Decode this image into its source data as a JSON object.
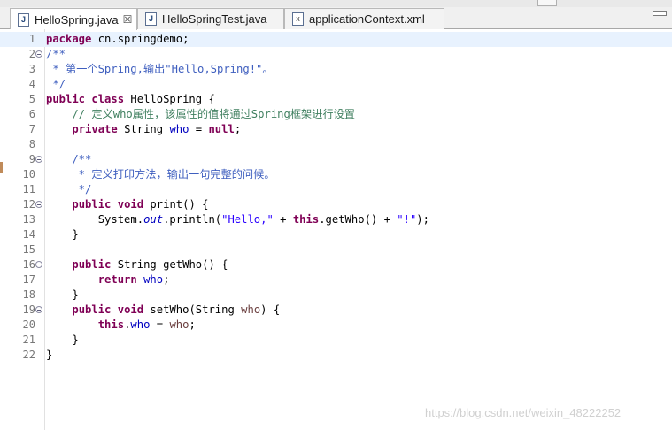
{
  "tabs": [
    {
      "label": "HelloSpring.java",
      "icon": "java-file-icon",
      "icon_glyph": "J",
      "active": true,
      "close": "☒"
    },
    {
      "label": "HelloSpringTest.java",
      "icon": "java-file-icon",
      "icon_glyph": "J",
      "active": false
    },
    {
      "label": "applicationContext.xml",
      "icon": "xml-file-icon",
      "icon_glyph": "x",
      "active": false
    }
  ],
  "editor": {
    "lines": [
      {
        "n": "1",
        "current": true,
        "fold": false,
        "tokens": [
          {
            "t": "package",
            "c": "kw"
          },
          {
            "t": " cn.springdemo;",
            "c": ""
          }
        ]
      },
      {
        "n": "2",
        "fold": true,
        "tokens": [
          {
            "t": "/**",
            "c": "cm"
          }
        ]
      },
      {
        "n": "3",
        "tokens": [
          {
            "t": " * 第一个Spring,输出\"Hello,Spring!\"。",
            "c": "cm"
          }
        ]
      },
      {
        "n": "4",
        "tokens": [
          {
            "t": " */",
            "c": "cm"
          }
        ]
      },
      {
        "n": "5",
        "tokens": [
          {
            "t": "public",
            "c": "kw"
          },
          {
            "t": " ",
            "c": ""
          },
          {
            "t": "class",
            "c": "kw"
          },
          {
            "t": " HelloSpring {",
            "c": ""
          }
        ]
      },
      {
        "n": "6",
        "tokens": [
          {
            "t": "    // 定义who属性，该属性的值将通过Spring框架进行设置",
            "c": "cl"
          }
        ]
      },
      {
        "n": "7",
        "tokens": [
          {
            "t": "    ",
            "c": ""
          },
          {
            "t": "private",
            "c": "kw"
          },
          {
            "t": " String ",
            "c": ""
          },
          {
            "t": "who",
            "c": "fld"
          },
          {
            "t": " = ",
            "c": ""
          },
          {
            "t": "null",
            "c": "kw"
          },
          {
            "t": ";",
            "c": ""
          }
        ]
      },
      {
        "n": "8",
        "tokens": []
      },
      {
        "n": "9",
        "fold": true,
        "tokens": [
          {
            "t": "    /**",
            "c": "cm"
          }
        ]
      },
      {
        "n": "10",
        "tokens": [
          {
            "t": "     * 定义打印方法，输出一句完整的问候。",
            "c": "cm"
          }
        ]
      },
      {
        "n": "11",
        "tokens": [
          {
            "t": "     */",
            "c": "cm"
          }
        ]
      },
      {
        "n": "12",
        "fold": true,
        "tokens": [
          {
            "t": "    ",
            "c": ""
          },
          {
            "t": "public",
            "c": "kw"
          },
          {
            "t": " ",
            "c": ""
          },
          {
            "t": "void",
            "c": "kw"
          },
          {
            "t": " print() {",
            "c": ""
          }
        ]
      },
      {
        "n": "13",
        "tokens": [
          {
            "t": "        System.",
            "c": ""
          },
          {
            "t": "out",
            "c": "sfld"
          },
          {
            "t": ".println(",
            "c": ""
          },
          {
            "t": "\"Hello,\"",
            "c": "str"
          },
          {
            "t": " + ",
            "c": ""
          },
          {
            "t": "this",
            "c": "kw"
          },
          {
            "t": ".getWho() + ",
            "c": ""
          },
          {
            "t": "\"!\"",
            "c": "str"
          },
          {
            "t": ");",
            "c": ""
          }
        ]
      },
      {
        "n": "14",
        "tokens": [
          {
            "t": "    }",
            "c": ""
          }
        ]
      },
      {
        "n": "15",
        "tokens": []
      },
      {
        "n": "16",
        "fold": true,
        "tokens": [
          {
            "t": "    ",
            "c": ""
          },
          {
            "t": "public",
            "c": "kw"
          },
          {
            "t": " String getWho() {",
            "c": ""
          }
        ]
      },
      {
        "n": "17",
        "tokens": [
          {
            "t": "        ",
            "c": ""
          },
          {
            "t": "return",
            "c": "kw"
          },
          {
            "t": " ",
            "c": ""
          },
          {
            "t": "who",
            "c": "fld"
          },
          {
            "t": ";",
            "c": ""
          }
        ]
      },
      {
        "n": "18",
        "tokens": [
          {
            "t": "    }",
            "c": ""
          }
        ]
      },
      {
        "n": "19",
        "fold": true,
        "tokens": [
          {
            "t": "    ",
            "c": ""
          },
          {
            "t": "public",
            "c": "kw"
          },
          {
            "t": " ",
            "c": ""
          },
          {
            "t": "void",
            "c": "kw"
          },
          {
            "t": " setWho(String ",
            "c": ""
          },
          {
            "t": "who",
            "c": "par"
          },
          {
            "t": ") {",
            "c": ""
          }
        ]
      },
      {
        "n": "20",
        "tokens": [
          {
            "t": "        ",
            "c": ""
          },
          {
            "t": "this",
            "c": "kw"
          },
          {
            "t": ".",
            "c": ""
          },
          {
            "t": "who",
            "c": "fld"
          },
          {
            "t": " = ",
            "c": ""
          },
          {
            "t": "who",
            "c": "par"
          },
          {
            "t": ";",
            "c": ""
          }
        ]
      },
      {
        "n": "21",
        "tokens": [
          {
            "t": "    }",
            "c": ""
          }
        ]
      },
      {
        "n": "22",
        "tokens": [
          {
            "t": "}",
            "c": ""
          }
        ]
      }
    ]
  },
  "watermark": "https://blog.csdn.net/weixin_48222252"
}
